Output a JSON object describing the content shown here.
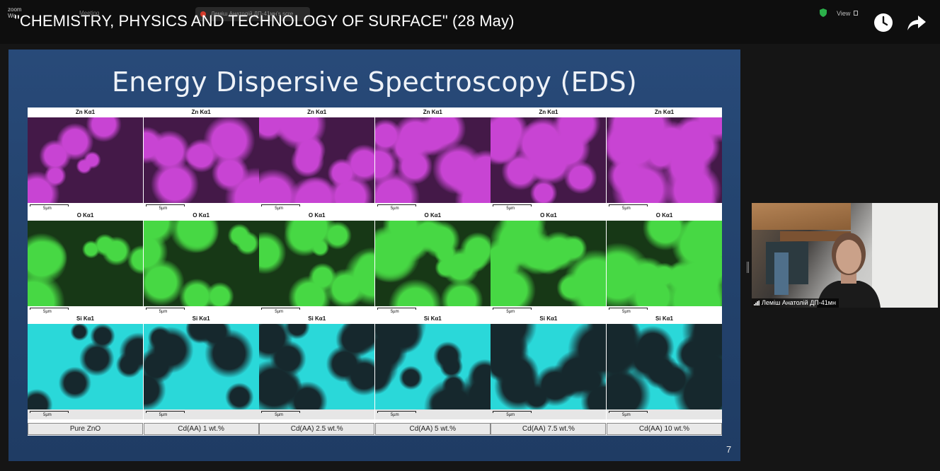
{
  "top_bar": {
    "zoom_logo": "zoom\nWo",
    "meeting_label": "Meeting",
    "presenter_label": "Леміш Анатолій ДП-41мн's scre",
    "video_title": "\"CHEMISTRY, PHYSICS AND TECHNOLOGY OF SURFACE\" (28 May)",
    "view_label": "View",
    "icons": {
      "shield": "shield-icon",
      "view": "view-icon",
      "watch_later": "clock-icon",
      "share": "share-icon"
    }
  },
  "slide": {
    "title": "Energy Dispersive Spectroscopy (EDS)",
    "page_number": "7",
    "rows": [
      {
        "element": "Zn Kα1",
        "color": "#c63bd1",
        "dark": "#3a0d3f"
      },
      {
        "element": "O Kα1",
        "color": "#3ed63a",
        "dark": "#0b2e0a"
      },
      {
        "element": "Si Kα1",
        "color": "#1fd6d8",
        "dark": "#062f33"
      }
    ],
    "scale_label": "5µm",
    "samples": [
      "Pure ZnO",
      "Cd(AA) 1 wt.%",
      "Cd(AA) 2.5 wt.%",
      "Cd(AA) 5 wt.%",
      "Cd(AA) 7.5 wt.%",
      "Cd(AA) 10 wt.%"
    ]
  },
  "webcam": {
    "participant_name": "Леміш Анатолій ДП-41мн"
  },
  "colors": {
    "background": "#151515",
    "slide_blue": "#24446f",
    "zn_magenta": "#c63bd1",
    "o_green": "#3ed63a",
    "si_cyan": "#1fd6d8"
  }
}
